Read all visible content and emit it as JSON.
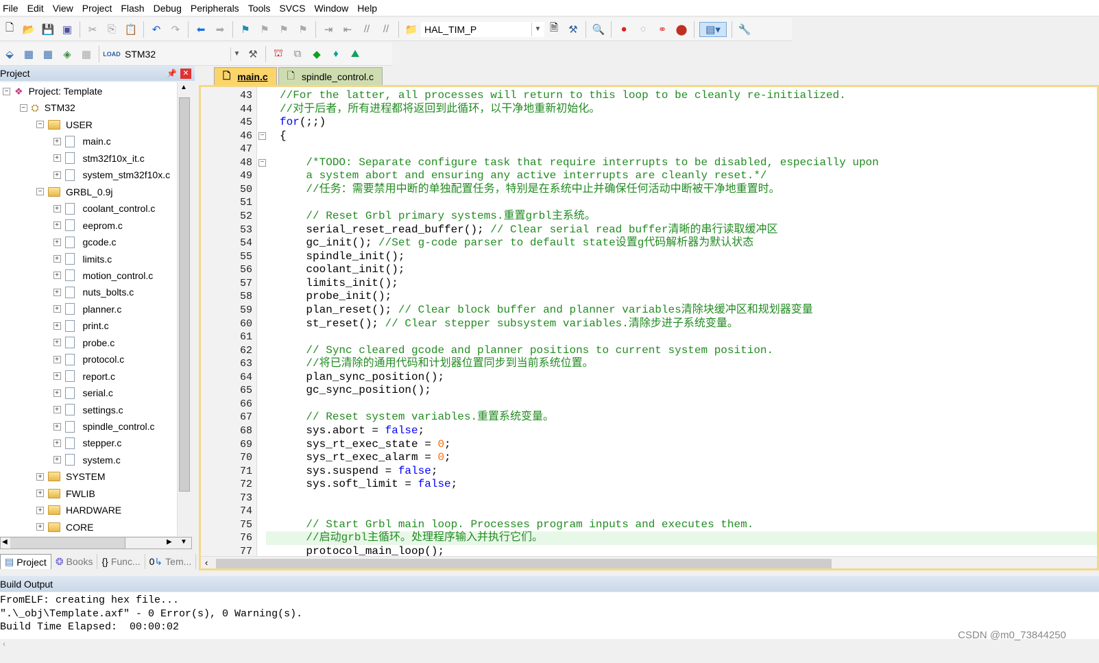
{
  "menu": [
    "File",
    "Edit",
    "View",
    "Project",
    "Flash",
    "Debug",
    "Peripherals",
    "Tools",
    "SVCS",
    "Window",
    "Help"
  ],
  "toolbar1": {
    "find_value": "HAL_TIM_P"
  },
  "toolbar2": {
    "target_value": "STM32"
  },
  "project_panel": {
    "title": "Project",
    "tree": [
      {
        "label": "Project: Template",
        "level": 0,
        "type": "root",
        "toggle": "−"
      },
      {
        "label": "STM32",
        "level": 1,
        "type": "target",
        "toggle": "−"
      },
      {
        "label": "USER",
        "level": 2,
        "type": "folder",
        "toggle": "−"
      },
      {
        "label": "main.c",
        "level": 3,
        "type": "file",
        "toggle": "+"
      },
      {
        "label": "stm32f10x_it.c",
        "level": 3,
        "type": "file",
        "toggle": "+"
      },
      {
        "label": "system_stm32f10x.c",
        "level": 3,
        "type": "file",
        "toggle": "+"
      },
      {
        "label": "GRBL_0.9j",
        "level": 2,
        "type": "folder",
        "toggle": "−"
      },
      {
        "label": "coolant_control.c",
        "level": 3,
        "type": "file",
        "toggle": "+"
      },
      {
        "label": "eeprom.c",
        "level": 3,
        "type": "file",
        "toggle": "+"
      },
      {
        "label": "gcode.c",
        "level": 3,
        "type": "file",
        "toggle": "+"
      },
      {
        "label": "limits.c",
        "level": 3,
        "type": "file",
        "toggle": "+"
      },
      {
        "label": "motion_control.c",
        "level": 3,
        "type": "file",
        "toggle": "+"
      },
      {
        "label": "nuts_bolts.c",
        "level": 3,
        "type": "file",
        "toggle": "+"
      },
      {
        "label": "planner.c",
        "level": 3,
        "type": "file",
        "toggle": "+"
      },
      {
        "label": "print.c",
        "level": 3,
        "type": "file",
        "toggle": "+"
      },
      {
        "label": "probe.c",
        "level": 3,
        "type": "file",
        "toggle": "+"
      },
      {
        "label": "protocol.c",
        "level": 3,
        "type": "file",
        "toggle": "+"
      },
      {
        "label": "report.c",
        "level": 3,
        "type": "file",
        "toggle": "+"
      },
      {
        "label": "serial.c",
        "level": 3,
        "type": "file",
        "toggle": "+"
      },
      {
        "label": "settings.c",
        "level": 3,
        "type": "file",
        "toggle": "+"
      },
      {
        "label": "spindle_control.c",
        "level": 3,
        "type": "file",
        "toggle": "+"
      },
      {
        "label": "stepper.c",
        "level": 3,
        "type": "file",
        "toggle": "+"
      },
      {
        "label": "system.c",
        "level": 3,
        "type": "file",
        "toggle": "+"
      },
      {
        "label": "SYSTEM",
        "level": 2,
        "type": "folder",
        "toggle": "+"
      },
      {
        "label": "FWLIB",
        "level": 2,
        "type": "folder",
        "toggle": "+"
      },
      {
        "label": "HARDWARE",
        "level": 2,
        "type": "folder",
        "toggle": "+"
      },
      {
        "label": "CORE",
        "level": 2,
        "type": "folder",
        "toggle": "+"
      }
    ],
    "tabs": [
      "Project",
      "Books",
      "Func...",
      "Tem..."
    ]
  },
  "editor": {
    "tabs": [
      "main.c",
      "spindle_control.c"
    ],
    "active_tab": 0,
    "lines": [
      {
        "n": "43",
        "s": [
          [
            "c",
            "//For the latter, all processes will return to this loop to be cleanly re-initialized."
          ]
        ]
      },
      {
        "n": "44",
        "s": [
          [
            "c",
            "//对于后者，所有进程都将返回到此循环，以干净地重新初始化。"
          ]
        ]
      },
      {
        "n": "45",
        "s": [
          [
            "k",
            "for"
          ],
          [
            "t",
            "(;;)"
          ]
        ]
      },
      {
        "n": "46",
        "fold": true,
        "s": [
          [
            "t",
            "{"
          ]
        ]
      },
      {
        "n": "47",
        "s": []
      },
      {
        "n": "48",
        "fold": true,
        "s": [
          [
            "c",
            "    /*TODO: Separate configure task that require interrupts to be disabled, especially upon"
          ]
        ]
      },
      {
        "n": "49",
        "s": [
          [
            "c",
            "    a system abort and ensuring any active interrupts are cleanly reset.*/"
          ]
        ]
      },
      {
        "n": "50",
        "s": [
          [
            "c",
            "    //任务：需要禁用中断的单独配置任务，特别是在系统中止并确保任何活动中断被干净地重置时。"
          ]
        ]
      },
      {
        "n": "51",
        "s": []
      },
      {
        "n": "52",
        "s": [
          [
            "c",
            "    // Reset Grbl primary systems.重置grbl主系统。"
          ]
        ]
      },
      {
        "n": "53",
        "s": [
          [
            "t",
            "    serial_reset_read_buffer(); "
          ],
          [
            "c",
            "// Clear serial read buffer清晰的串行读取缓冲区"
          ]
        ]
      },
      {
        "n": "54",
        "s": [
          [
            "t",
            "    gc_init(); "
          ],
          [
            "c",
            "//Set g-code parser to default state设置g代码解析器为默认状态"
          ]
        ]
      },
      {
        "n": "55",
        "s": [
          [
            "t",
            "    spindle_init();"
          ]
        ]
      },
      {
        "n": "56",
        "s": [
          [
            "t",
            "    coolant_init();"
          ]
        ]
      },
      {
        "n": "57",
        "s": [
          [
            "t",
            "    limits_init();"
          ]
        ]
      },
      {
        "n": "58",
        "s": [
          [
            "t",
            "    probe_init();"
          ]
        ]
      },
      {
        "n": "59",
        "s": [
          [
            "t",
            "    plan_reset(); "
          ],
          [
            "c",
            "// Clear block buffer and planner variables清除块缓冲区和规划器变量"
          ]
        ]
      },
      {
        "n": "60",
        "s": [
          [
            "t",
            "    st_reset(); "
          ],
          [
            "c",
            "// Clear stepper subsystem variables.清除步进子系统变量。"
          ]
        ]
      },
      {
        "n": "61",
        "s": []
      },
      {
        "n": "62",
        "s": [
          [
            "c",
            "    // Sync cleared gcode and planner positions to current system position."
          ]
        ]
      },
      {
        "n": "63",
        "s": [
          [
            "c",
            "    //将已清除的通用代码和计划器位置同步到当前系统位置。"
          ]
        ]
      },
      {
        "n": "64",
        "s": [
          [
            "t",
            "    plan_sync_position();"
          ]
        ]
      },
      {
        "n": "65",
        "s": [
          [
            "t",
            "    gc_sync_position();"
          ]
        ]
      },
      {
        "n": "66",
        "s": []
      },
      {
        "n": "67",
        "s": [
          [
            "c",
            "    // Reset system variables.重置系统变量。"
          ]
        ]
      },
      {
        "n": "68",
        "s": [
          [
            "t",
            "    sys.abort = "
          ],
          [
            "k",
            "false"
          ],
          [
            "t",
            ";"
          ]
        ]
      },
      {
        "n": "69",
        "s": [
          [
            "t",
            "    sys_rt_exec_state = "
          ],
          [
            "n",
            "0"
          ],
          [
            "t",
            ";"
          ]
        ]
      },
      {
        "n": "70",
        "s": [
          [
            "t",
            "    sys_rt_exec_alarm = "
          ],
          [
            "n",
            "0"
          ],
          [
            "t",
            ";"
          ]
        ]
      },
      {
        "n": "71",
        "s": [
          [
            "t",
            "    sys.suspend = "
          ],
          [
            "k",
            "false"
          ],
          [
            "t",
            ";"
          ]
        ]
      },
      {
        "n": "72",
        "s": [
          [
            "t",
            "    sys.soft_limit = "
          ],
          [
            "k",
            "false"
          ],
          [
            "t",
            ";"
          ]
        ]
      },
      {
        "n": "73",
        "s": []
      },
      {
        "n": "74",
        "s": []
      },
      {
        "n": "75",
        "s": [
          [
            "c",
            "    // Start Grbl main loop. Processes program inputs and executes them."
          ]
        ]
      },
      {
        "n": "76",
        "hl": true,
        "s": [
          [
            "c",
            "    //启动grbl主循环。处理程序输入并执行它们。"
          ]
        ]
      },
      {
        "n": "77",
        "s": [
          [
            "t",
            "    protocol_main_loop();"
          ]
        ]
      }
    ]
  },
  "build_output": {
    "title": "Build Output",
    "lines": [
      "FromELF: creating hex file...",
      "\".\\_obj\\Template.axf\" - 0 Error(s), 0 Warning(s).",
      "Build Time Elapsed:  00:00:02"
    ]
  },
  "watermark": "CSDN @m0_73844250"
}
